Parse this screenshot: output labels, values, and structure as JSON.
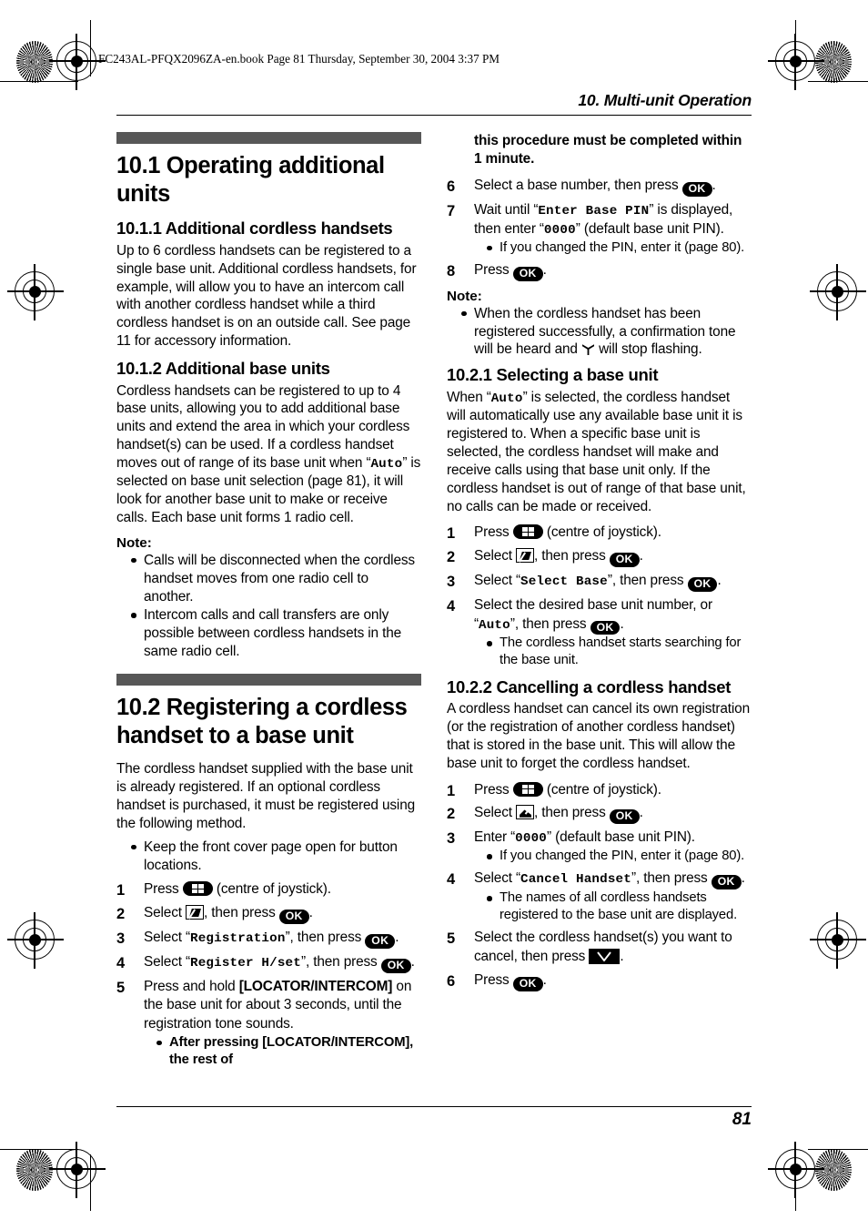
{
  "file_info": "FC243AL-PFQX2096ZA-en.book  Page 81  Thursday, September 30, 2004  3:37 PM",
  "running_head": "10. Multi-unit Operation",
  "page_number": "81",
  "icons": {
    "ok": "OK",
    "joystick": "joystick-centre-icon",
    "softkey_edit": "softkey-edit-icon",
    "softkey_photo": "softkey-photo-icon",
    "check": "check-softkey-icon",
    "antenna": "antenna-icon"
  },
  "left_column": {
    "section_10_1": {
      "title": "10.1 Operating additional units",
      "sub_10_1_1": {
        "title": "10.1.1 Additional cordless handsets",
        "body": "Up to 6 cordless handsets can be registered to a single base unit. Additional cordless handsets, for example, will allow you to have an intercom call with another cordless handset while a third cordless handset is on an outside call. See page 11 for accessory information."
      },
      "sub_10_1_2": {
        "title": "10.1.2 Additional base units",
        "body_part1": "Cordless handsets can be registered to up to 4 base units, allowing you to add additional base units and extend the area in which your cordless handset(s) can be used. If a cordless handset moves out of range of its base unit when “",
        "body_lcd": "Auto",
        "body_part2": "” is selected on base unit selection (page 81), it will look for another base unit to make or receive calls. Each base unit forms 1 radio cell.",
        "note_label": "Note:",
        "notes": [
          "Calls will be disconnected when the cordless handset moves from one radio cell to another.",
          "Intercom calls and call transfers are only possible between cordless handsets in the same radio cell."
        ]
      }
    },
    "section_10_2": {
      "title": "10.2 Registering a cordless handset to a base unit",
      "body": "The cordless handset supplied with the base unit is already registered. If an optional cordless handset is purchased, it must be registered using the following method.",
      "pre_bullets": [
        "Keep the front cover page open for button locations."
      ],
      "steps": [
        {
          "num": "1",
          "pre": "Press ",
          "icon": "joystick",
          "post": " (centre of joystick)."
        },
        {
          "num": "2",
          "pre": "Select ",
          "icon": "softkey_edit",
          "mid": ", then press ",
          "icon2": "ok",
          "post": "."
        },
        {
          "num": "3",
          "pre": "Select “",
          "lcd": "Registration",
          "mid": "”, then press ",
          "icon2": "ok",
          "post": "."
        },
        {
          "num": "4",
          "pre": "Select “",
          "lcd": "Register H/set",
          "mid": "”, then press ",
          "icon2": "ok",
          "post": "."
        },
        {
          "num": "5",
          "pre": "Press and hold ",
          "kb": "[LOCATOR/INTERCOM]",
          "post": " on the base unit for about 3 seconds, until the registration tone sounds.",
          "sub_bullet_part1": "After pressing ",
          "sub_bullet_kb": "[LOCATOR/INTERCOM]",
          "sub_bullet_part2": ", the rest of"
        }
      ]
    }
  },
  "right_column": {
    "continued_bold": "this procedure must be completed within 1 minute.",
    "steps_continued": [
      {
        "num": "6",
        "pre": "Select a base number, then press ",
        "icon2": "ok",
        "post": "."
      },
      {
        "num": "7",
        "pre": "Wait until “",
        "lcd": "Enter Base PIN",
        "mid": "” is displayed, then enter “",
        "lcd2": "0000",
        "post": "” (default base unit PIN).",
        "sub_bullet": "If you changed the PIN, enter it (page 80)."
      },
      {
        "num": "8",
        "pre": "Press ",
        "icon2": "ok",
        "post": "."
      }
    ],
    "note_label": "Note:",
    "note_part1": "When the cordless handset has been registered successfully, a confirmation tone will be heard and ",
    "note_part2": " will stop flashing.",
    "sub_10_2_1": {
      "title": "10.2.1 Selecting a base unit",
      "body_part1": "When “",
      "body_lcd": "Auto",
      "body_part2": "” is selected, the cordless handset will automatically use any available base unit it is registered to. When a specific base unit is selected, the cordless handset will make and receive calls using that base unit only. If the cordless handset is out of range of that base unit, no calls can be made or received.",
      "steps": [
        {
          "num": "1",
          "pre": "Press ",
          "icon": "joystick",
          "post": " (centre of joystick)."
        },
        {
          "num": "2",
          "pre": "Select ",
          "icon": "softkey_edit",
          "mid": ", then press ",
          "icon2": "ok",
          "post": "."
        },
        {
          "num": "3",
          "pre": "Select “",
          "lcd": "Select Base",
          "mid": "”, then press ",
          "icon2": "ok",
          "post": "."
        },
        {
          "num": "4",
          "pre": "Select the desired base unit number, or “",
          "lcd": "Auto",
          "mid": "”, then press ",
          "icon2": "ok",
          "post": ".",
          "sub_bullet": "The cordless handset starts searching for the base unit."
        }
      ]
    },
    "sub_10_2_2": {
      "title": "10.2.2 Cancelling a cordless handset",
      "body": "A cordless handset can cancel its own registration (or the registration of another cordless handset) that is stored in the base unit. This will allow the base unit to forget the cordless handset.",
      "steps": [
        {
          "num": "1",
          "pre": "Press ",
          "icon": "joystick",
          "post": " (centre of joystick)."
        },
        {
          "num": "2",
          "pre": "Select ",
          "icon": "softkey_photo",
          "mid": ", then press ",
          "icon2": "ok",
          "post": "."
        },
        {
          "num": "3",
          "pre": "Enter “",
          "lcd": "0000",
          "post": "” (default base unit PIN).",
          "sub_bullet": "If you changed the PIN, enter it (page 80)."
        },
        {
          "num": "4",
          "pre": "Select “",
          "lcd": "Cancel Handset",
          "mid": "”, then press ",
          "icon2": "ok",
          "post": ".",
          "sub_bullet": "The names of all cordless handsets registered to the base unit are displayed."
        },
        {
          "num": "5",
          "pre": "Select the cordless handset(s) you want to cancel, then press ",
          "icon2": "check",
          "post": "."
        },
        {
          "num": "6",
          "pre": "Press ",
          "icon2": "ok",
          "post": "."
        }
      ]
    }
  }
}
